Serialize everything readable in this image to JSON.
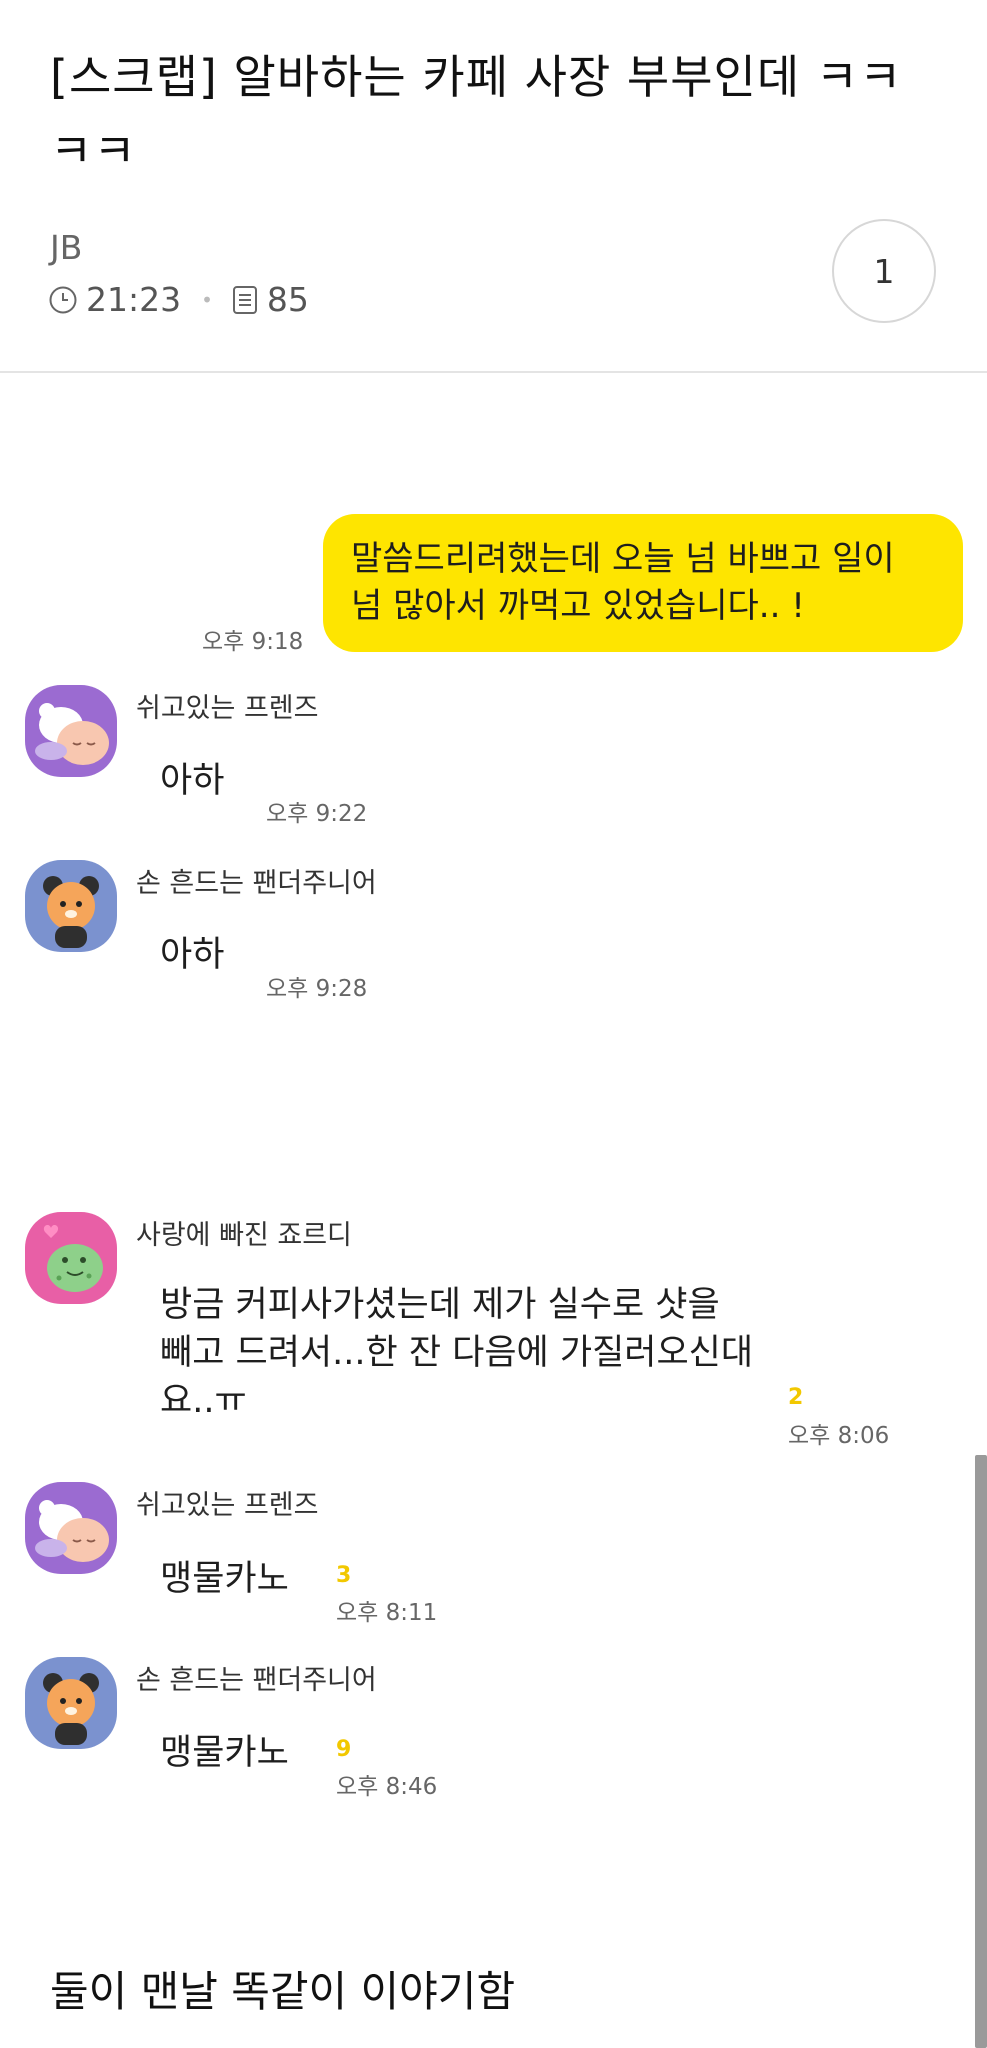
{
  "post": {
    "title": "[스크랩] 알바하는 카페 사장 부부인데 ㅋㅋㅋㅋ",
    "author": "JB",
    "time": "21:23",
    "views": "85",
    "comment_count": "1"
  },
  "chat": {
    "my_message": {
      "text": "말씀드리려했는데 오늘 넘 바쁘고 일이 넘 많아서 까먹고 있었습니다.. !",
      "time": "오후 9:18"
    },
    "group1": [
      {
        "name": "쉬고있는 프렌즈",
        "text": "아하",
        "time": "오후 9:22"
      },
      {
        "name": "손 흔드는 팬더주니어",
        "text": "아하",
        "time": "오후 9:28"
      }
    ],
    "jordy": {
      "name": "사랑에 빠진 죠르디",
      "text": "방금 커피사가셨는데 제가 실수로 샷을 빼고 드려서...한 잔 다음에 가질러오신대요..ㅠ",
      "unread": "2",
      "time": "오후 8:06"
    },
    "group2": [
      {
        "name": "쉬고있는 프렌즈",
        "text": "맹물카노",
        "unread": "3",
        "time": "오후 8:11"
      },
      {
        "name": "손 흔드는 팬더주니어",
        "text": "맹물카노",
        "unread": "9",
        "time": "오후 8:46"
      }
    ]
  },
  "caption": "둘이 맨날 똑같이 이야기함",
  "colors": {
    "bubble_yellow": "#fee500",
    "unread_yellow": "#f2c800",
    "avatar_purple": "#9b6bd1",
    "avatar_blue": "#7b92cf",
    "avatar_pink": "#e85fa6"
  },
  "icons": [
    "clock-icon",
    "document-icon"
  ]
}
